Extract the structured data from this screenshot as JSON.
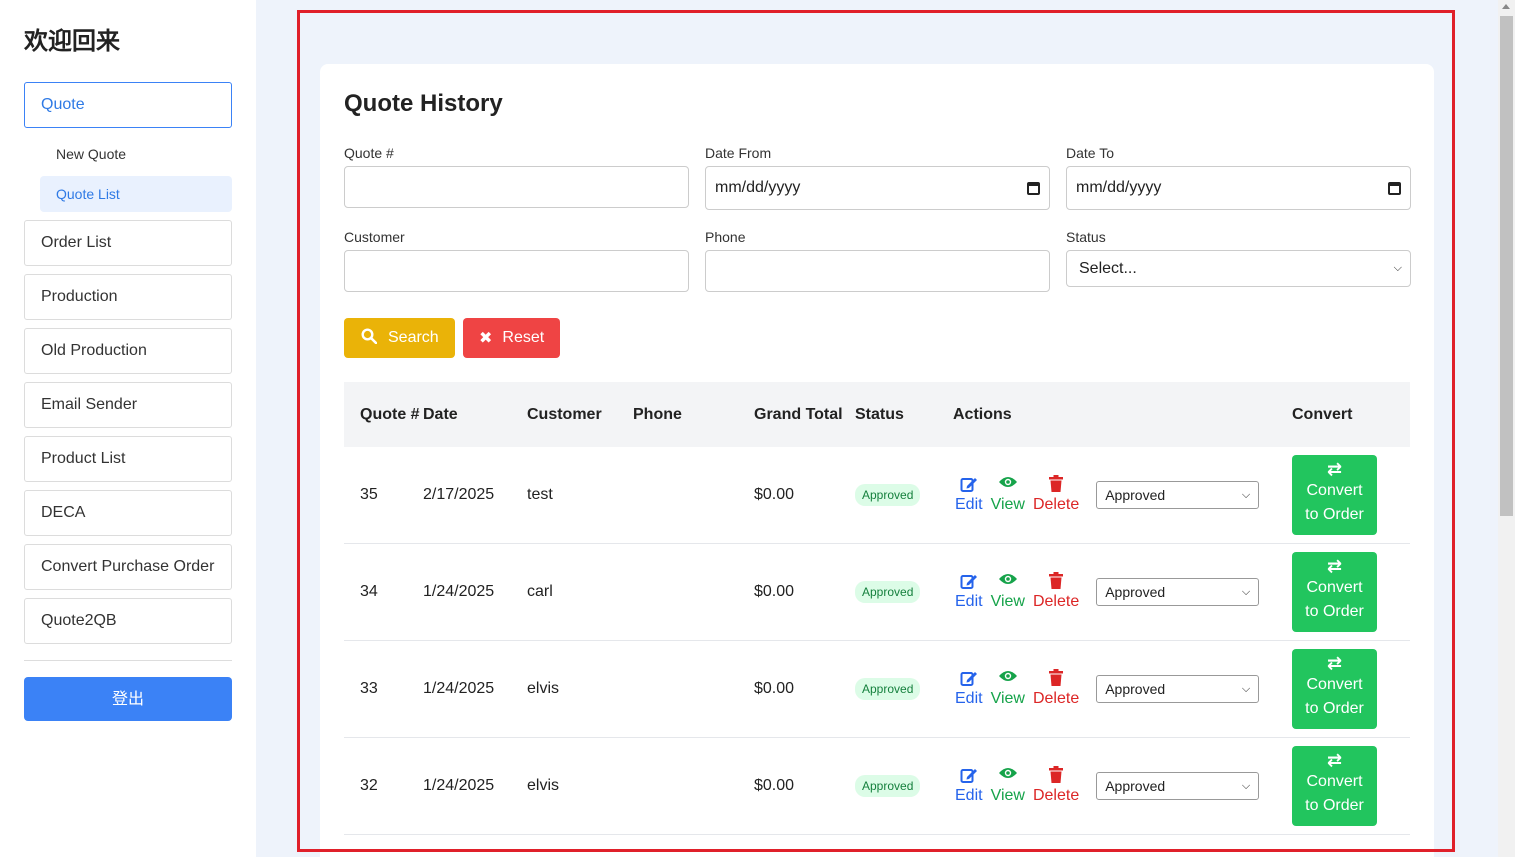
{
  "sidebar": {
    "title": "欢迎回来",
    "items": [
      "Quote",
      "Order List",
      "Production",
      "Old Production",
      "Email Sender",
      "Product List",
      "DECA",
      "Convert Purchase Order",
      "Quote2QB"
    ],
    "sub_items": [
      "New Quote",
      "Quote List"
    ],
    "logout": "登出"
  },
  "main": {
    "title": "Quote History",
    "filters": {
      "quote_label": "Quote #",
      "date_from_label": "Date From",
      "date_to_label": "Date To",
      "date_placeholder": "mm/dd/yyyy",
      "customer_label": "Customer",
      "phone_label": "Phone",
      "status_label": "Status",
      "status_value": "Select..."
    },
    "buttons": {
      "search": "Search",
      "reset": "Reset"
    },
    "table": {
      "headers": [
        "Quote #",
        "Date",
        "Customer",
        "Phone",
        "Grand Total",
        "Status",
        "Actions",
        "Convert"
      ],
      "rows": [
        {
          "quote": "35",
          "date": "2/17/2025",
          "customer": "test",
          "phone": "",
          "total": "$0.00",
          "status": "Approved",
          "select": "Approved"
        },
        {
          "quote": "34",
          "date": "1/24/2025",
          "customer": "carl",
          "phone": "",
          "total": "$0.00",
          "status": "Approved",
          "select": "Approved"
        },
        {
          "quote": "33",
          "date": "1/24/2025",
          "customer": "elvis",
          "phone": "",
          "total": "$0.00",
          "status": "Approved",
          "select": "Approved"
        },
        {
          "quote": "32",
          "date": "1/24/2025",
          "customer": "elvis",
          "phone": "",
          "total": "$0.00",
          "status": "Approved",
          "select": "Approved"
        }
      ],
      "actions": {
        "edit": "Edit",
        "view": "View",
        "delete": "Delete"
      },
      "convert_line1": "Convert",
      "convert_line2": "to Order"
    }
  },
  "colors": {
    "accent": "#3b82f6",
    "search": "#eab308",
    "reset": "#ef4444",
    "convert": "#22c55e",
    "highlight": "#e0202a"
  }
}
